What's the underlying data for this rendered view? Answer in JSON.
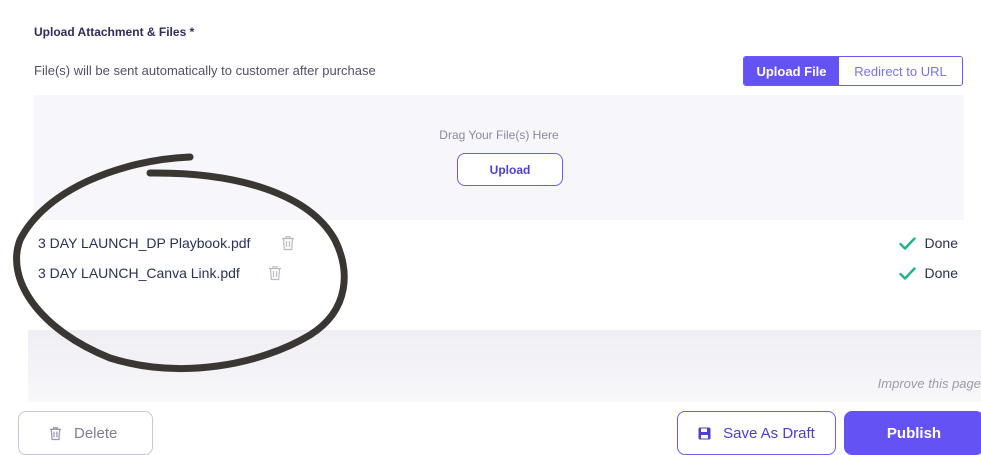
{
  "attachments": {
    "title": "Upload Attachment & Files *",
    "helper": "File(s) will be sent automatically to customer after purchase",
    "mode_tabs": [
      {
        "label": "Upload File",
        "active": true
      },
      {
        "label": "Redirect to URL",
        "active": false
      }
    ],
    "dropzone": {
      "prompt": "Drag Your File(s) Here",
      "button_label": "Upload"
    },
    "files": [
      {
        "name": "3 DAY LAUNCH_DP Playbook.pdf",
        "status": "Done",
        "icon": "trash-icon"
      },
      {
        "name": "3 DAY LAUNCH_Canva Link.pdf",
        "status": "Done",
        "icon": "trash-icon"
      }
    ]
  },
  "improve_link": "Improve this page",
  "actions": {
    "delete_label": "Delete",
    "save_draft_label": "Save As Draft",
    "publish_label": "Publish"
  },
  "icons": {
    "delete": "trash-icon",
    "save_draft": "floppy-disk-icon",
    "done": "checkmark-icon"
  },
  "colors": {
    "accent": "#6552f4",
    "success": "#1fb587",
    "text": "#27315a",
    "annotation": "#3a3632"
  }
}
